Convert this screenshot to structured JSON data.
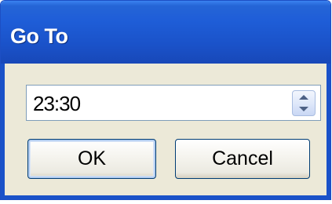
{
  "window": {
    "title": "Go To"
  },
  "time_input": {
    "value": "23:30"
  },
  "buttons": {
    "ok_label": "OK",
    "cancel_label": "Cancel"
  },
  "icons": {
    "spin_up": "chevron-up-icon",
    "spin_down": "chevron-down-icon"
  },
  "colors": {
    "titlebar": "#1f5ed8",
    "dialog_background": "#ece9d8",
    "title_text": "#ffffff"
  }
}
